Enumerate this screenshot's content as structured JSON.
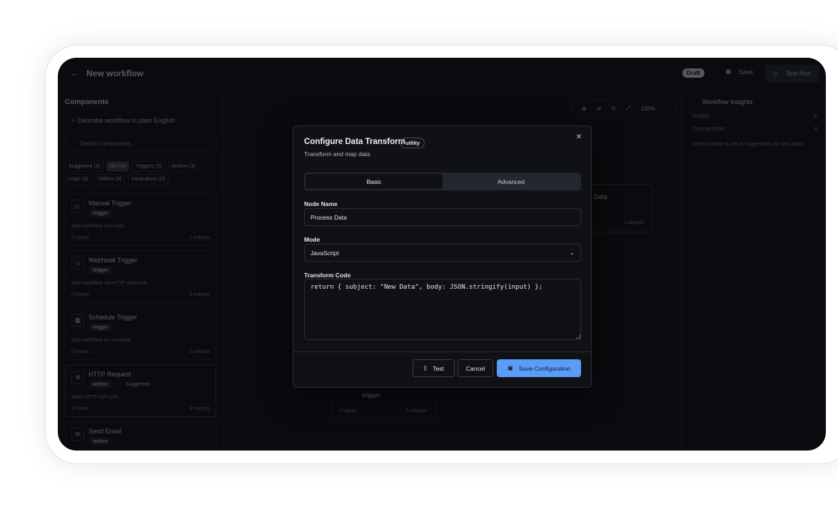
{
  "header": {
    "back_icon": "arrow-left-icon",
    "title": "New workflow",
    "status_badge": "Draft",
    "save_label": "Save",
    "test_run_label": "Test Run"
  },
  "sidebar": {
    "title": "Components",
    "describe_label": "Describe workflow in plain English",
    "search_placeholder": "Search components...",
    "filters": [
      "Suggested (3)",
      "All (14)",
      "Triggers (3)",
      "Actions (3)",
      "Logic (3)",
      "Utilities (5)",
      "Integrations (0)"
    ],
    "active_filter": "All (14)",
    "components": [
      {
        "name": "Manual Trigger",
        "tag": "trigger",
        "desc": "Start workflow manually",
        "inputs": "0 inputs",
        "outputs": "1 outputs",
        "icon": "play-icon"
      },
      {
        "name": "Webhook Trigger",
        "tag": "trigger",
        "desc": "Start workflow via HTTP webhook",
        "inputs": "0 inputs",
        "outputs": "3 outputs",
        "icon": "user-icon"
      },
      {
        "name": "Schedule Trigger",
        "tag": "trigger",
        "desc": "Start workflow on schedule",
        "inputs": "0 inputs",
        "outputs": "1 outputs",
        "icon": "calendar-icon"
      },
      {
        "name": "HTTP Request",
        "tag": "action",
        "extra": "Suggested",
        "desc": "Make HTTP API calls",
        "inputs": "3 inputs",
        "outputs": "3 outputs",
        "icon": "globe-icon"
      },
      {
        "name": "Send Email",
        "tag": "action",
        "desc": "",
        "inputs": "",
        "outputs": "",
        "icon": "mail-icon"
      }
    ]
  },
  "canvas": {
    "zoom_level": "100%",
    "node_process": {
      "name": "ss Data",
      "outputs": "1 outputs"
    },
    "node_trigger": {
      "tag": "trigger",
      "inputs": "0 inputs",
      "outputs": "3 outputs"
    }
  },
  "insights": {
    "title": "Workflow Insights",
    "nodes_label": "Nodes:",
    "nodes_value": "5",
    "connections_label": "Connections:",
    "connections_value": "4",
    "tip": "Select a node to see AI suggestions for next steps"
  },
  "modal": {
    "title": "Configure Data Transform",
    "badge": "utility",
    "subtitle": "Transform and map data",
    "tabs": [
      "Basic",
      "Advanced"
    ],
    "active_tab": "Basic",
    "node_name_label": "Node Name",
    "node_name_value": "Process Data",
    "mode_label": "Mode",
    "mode_value": "JavaScript",
    "code_label": "Transform Code",
    "code_value": "return { subject: \"New Data\", body: JSON.stringify(input) };",
    "test_label": "Test",
    "cancel_label": "Cancel",
    "save_label": "Save Configuration"
  },
  "colors": {
    "background": "#0a0b0e",
    "accent": "#5b9cf6",
    "panel": "#0f1115"
  }
}
